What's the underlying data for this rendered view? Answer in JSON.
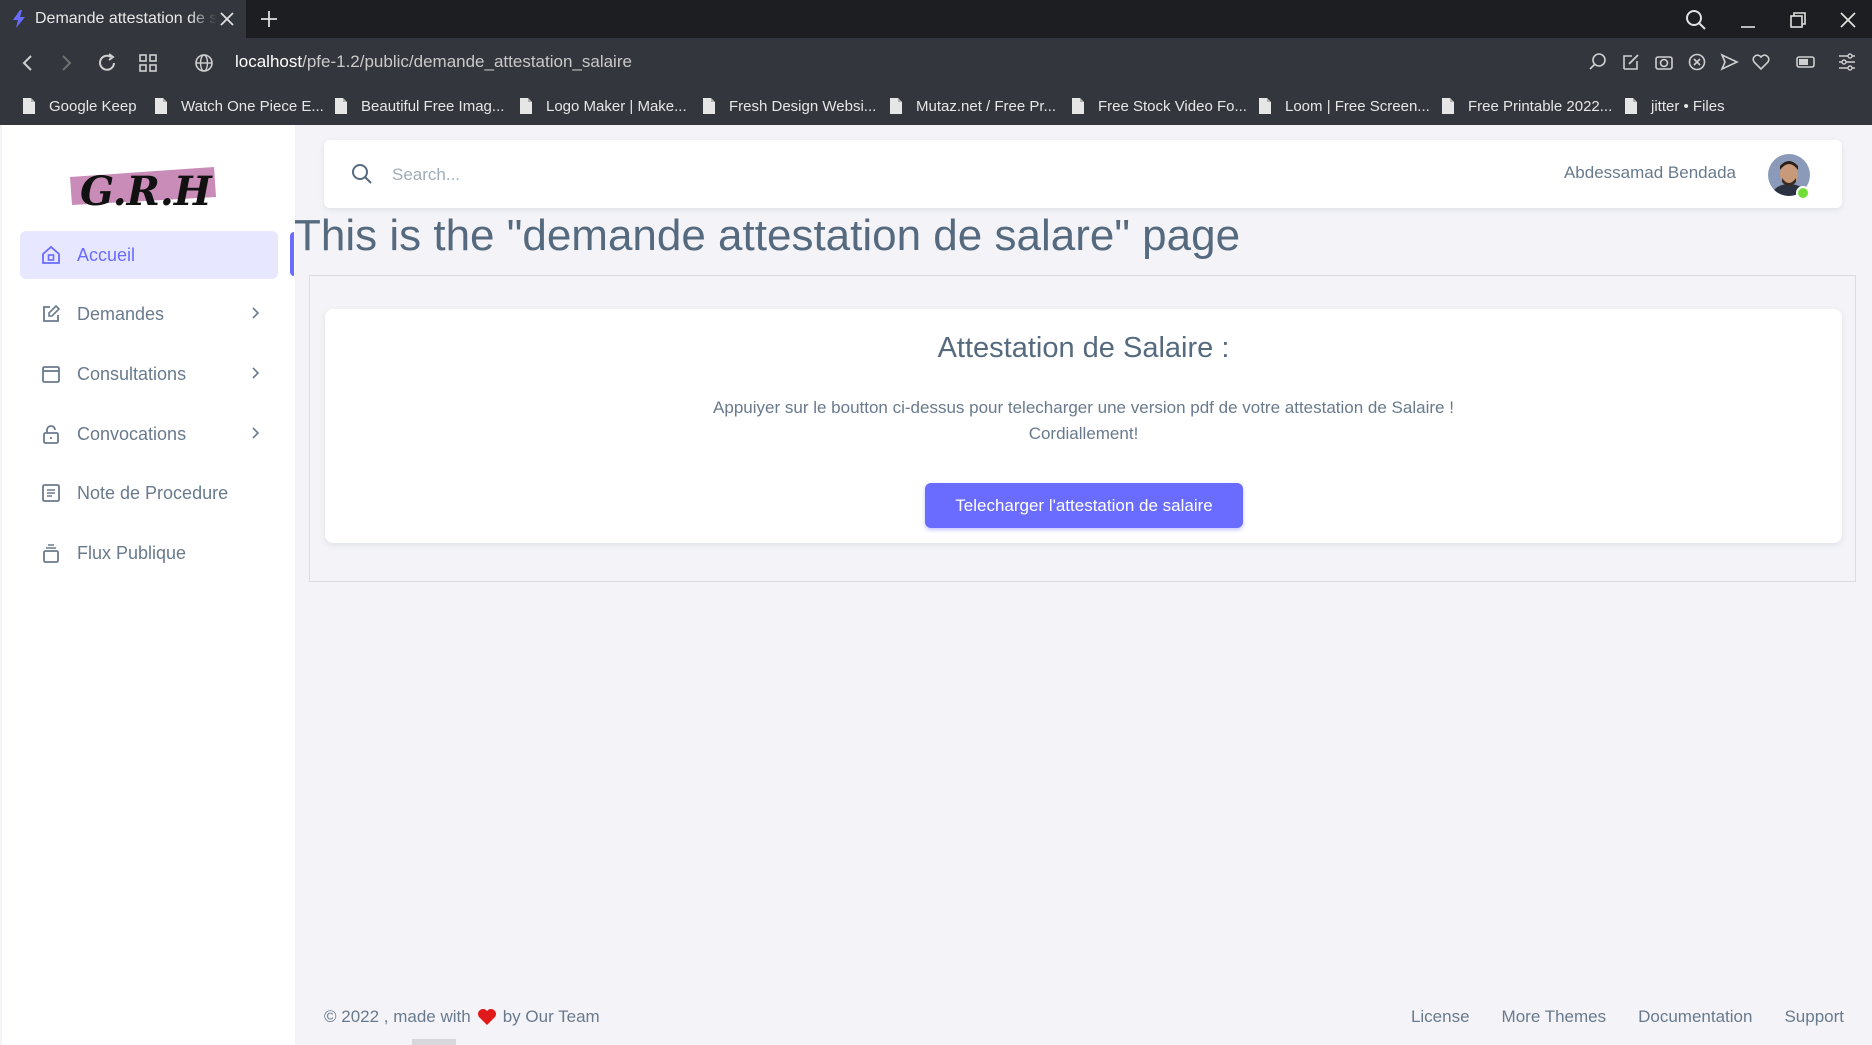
{
  "browser": {
    "tab_title": "Demande attestation de salaire",
    "url_host": "localhost",
    "url_path": "/pfe-1.2/public/demande_attestation_salaire",
    "bookmarks": [
      "Google Keep",
      "Watch One Piece E...",
      "Beautiful Free Imag...",
      "Logo Maker | Make...",
      "Fresh Design Websi...",
      "Mutaz.net / Free Pr...",
      "Free Stock Video Fo...",
      "Loom | Free Screen...",
      "Free Printable 2022...",
      "jitter • Files"
    ]
  },
  "app": {
    "logo_text": "G.R.H",
    "sidebar": [
      {
        "label": "Accueil",
        "icon": "home-icon",
        "active": true
      },
      {
        "label": "Demandes",
        "icon": "edit-icon",
        "submenu": true
      },
      {
        "label": "Consultations",
        "icon": "window-icon",
        "submenu": true
      },
      {
        "label": "Convocations",
        "icon": "lock-icon",
        "submenu": true
      },
      {
        "label": "Note de Procedure",
        "icon": "document-icon"
      },
      {
        "label": "Flux Publique",
        "icon": "stack-icon"
      }
    ],
    "search": {
      "placeholder": "Search..."
    },
    "user": {
      "name": "Abdessamad Bendada"
    },
    "page_heading": "This is the \"demande attestation de salare\" page",
    "card": {
      "title": "Attestation de Salaire :",
      "line1": "Appuiyer sur le boutton ci-dessus pour telecharger une version pdf de votre attestation de Salaire !",
      "line2": "Cordiallement!",
      "button": "Telecharger l'attestation de salaire"
    },
    "footer": {
      "copyright_prefix": "© 2022 , made with",
      "copyright_suffix": "by Our Team",
      "links": [
        "License",
        "More Themes",
        "Documentation",
        "Support"
      ]
    },
    "colors": {
      "accent": "#696cff",
      "text": "#697a8d",
      "heading": "#566a7f",
      "background": "#f4f4f8"
    }
  }
}
